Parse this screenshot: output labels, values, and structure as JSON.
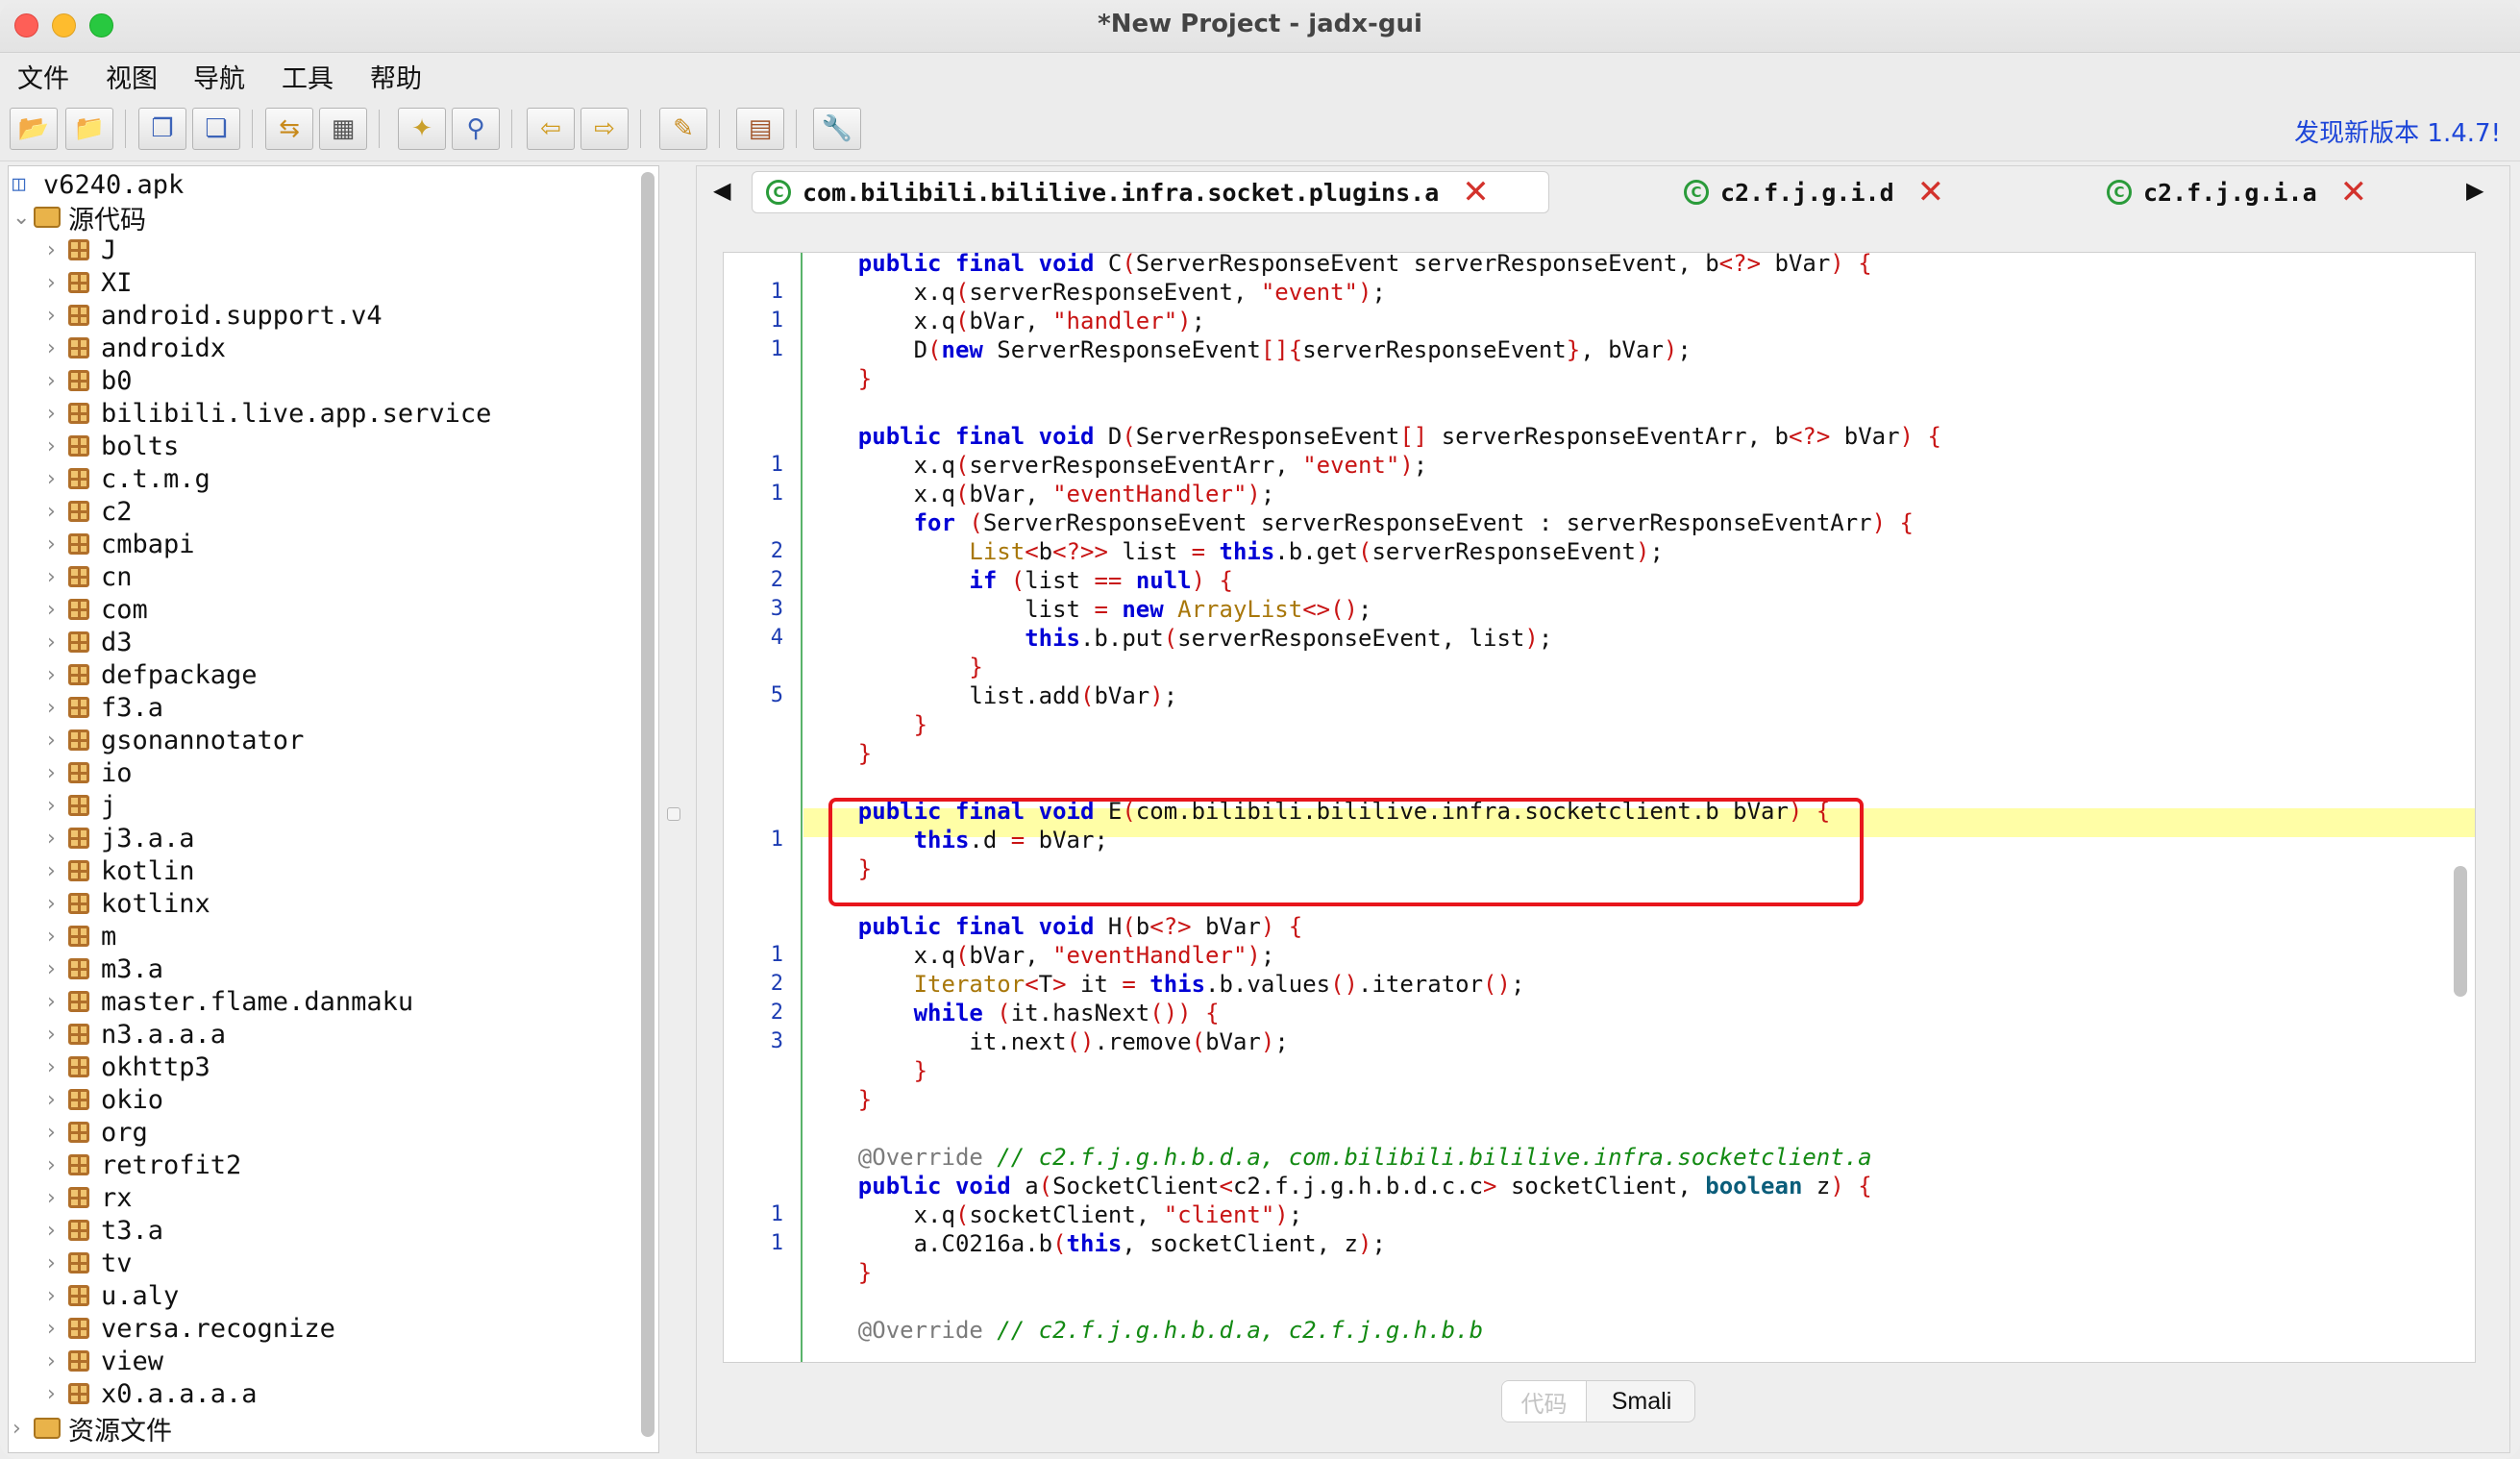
{
  "window": {
    "title": "*New Project - jadx-gui"
  },
  "menu": [
    "文件",
    "视图",
    "导航",
    "工具",
    "帮助"
  ],
  "toolbar": {
    "update_text": "发现新版本 1.4.7!",
    "buttons": [
      "open-file",
      "add-file",
      "save-all",
      "export",
      "sync",
      "decompile",
      "wand",
      "search",
      "back",
      "forward",
      "log",
      "deobf",
      "preferences"
    ]
  },
  "tree": {
    "root": "v6240.apk",
    "source_label": "源代码",
    "packages": [
      "J",
      "XI",
      "android.support.v4",
      "androidx",
      "b0",
      "bilibili.live.app.service",
      "bolts",
      "c.t.m.g",
      "c2",
      "cmbapi",
      "cn",
      "com",
      "d3",
      "defpackage",
      "f3.a",
      "gsonannotator",
      "io",
      "j",
      "j3.a.a",
      "kotlin",
      "kotlinx",
      "m",
      "m3.a",
      "master.flame.danmaku",
      "n3.a.a.a",
      "okhttp3",
      "okio",
      "org",
      "retrofit2",
      "rx",
      "t3.a",
      "tv",
      "u.aly",
      "versa.recognize",
      "view",
      "x0.a.a.a.a"
    ],
    "resources_label": "资源文件"
  },
  "tabs": [
    {
      "label": "com.bilibili.bililive.infra.socket.plugins.a",
      "active": true
    },
    {
      "label": "c2.f.j.g.i.d",
      "active": false
    },
    {
      "label": "c2.f.j.g.i.a",
      "active": false
    }
  ],
  "bottom_tabs": {
    "code": "代码",
    "smali": "Smali"
  },
  "code_lines": [
    {
      "n": "",
      "html": "    <span class='k'>public final void</span> C<span class='o'>(</span>ServerResponseEvent serverResponseEvent, b<span class='o'>&lt;?&gt;</span> bVar<span class='o'>)</span> <span class='o'>{</span>"
    },
    {
      "n": "1",
      "html": "        x.q<span class='o'>(</span>serverResponseEvent, <span class='o'>\"event\"</span><span class='o'>)</span>;"
    },
    {
      "n": "1",
      "html": "        x.q<span class='o'>(</span>bVar, <span class='o'>\"handler\"</span><span class='o'>)</span>;"
    },
    {
      "n": "1",
      "html": "        D<span class='o'>(</span><span class='k'>new</span> ServerResponseEvent<span class='o'>[]{</span>serverResponseEvent<span class='o'>}</span>, bVar<span class='o'>)</span>;"
    },
    {
      "n": "",
      "html": "    <span class='o'>}</span>"
    },
    {
      "n": "",
      "html": ""
    },
    {
      "n": "",
      "html": "    <span class='k'>public final void</span> D<span class='o'>(</span>ServerResponseEvent<span class='o'>[]</span> serverResponseEventArr, b<span class='o'>&lt;?&gt;</span> bVar<span class='o'>)</span> <span class='o'>{</span>"
    },
    {
      "n": "1",
      "html": "        x.q<span class='o'>(</span>serverResponseEventArr, <span class='o'>\"event\"</span><span class='o'>)</span>;"
    },
    {
      "n": "1",
      "html": "        x.q<span class='o'>(</span>bVar, <span class='o'>\"eventHandler\"</span><span class='o'>)</span>;"
    },
    {
      "n": "",
      "html": "        <span class='k'>for</span> <span class='o'>(</span>ServerResponseEvent serverResponseEvent : serverResponseEventArr<span class='o'>)</span> <span class='o'>{</span>"
    },
    {
      "n": "2",
      "html": "            <span class='ty'>List</span><span class='o'>&lt;</span>b<span class='o'>&lt;?&gt;&gt;</span> list <span class='o'>=</span> <span class='k'>this</span>.b.get<span class='o'>(</span>serverResponseEvent<span class='o'>)</span>;"
    },
    {
      "n": "2",
      "html": "            <span class='k'>if</span> <span class='o'>(</span>list <span class='o'>==</span> <span class='k'>null</span><span class='o'>)</span> <span class='o'>{</span>"
    },
    {
      "n": "3",
      "html": "                list <span class='o'>=</span> <span class='k'>new</span> <span class='ty'>ArrayList</span><span class='o'>&lt;&gt;()</span>;"
    },
    {
      "n": "4",
      "html": "                <span class='k'>this</span>.b.put<span class='o'>(</span>serverResponseEvent, list<span class='o'>)</span>;"
    },
    {
      "n": "",
      "html": "            <span class='o'>}</span>"
    },
    {
      "n": "5",
      "html": "            list.add<span class='o'>(</span>bVar<span class='o'>)</span>;"
    },
    {
      "n": "",
      "html": "        <span class='o'>}</span>"
    },
    {
      "n": "",
      "html": "    <span class='o'>}</span>"
    },
    {
      "n": "",
      "html": ""
    },
    {
      "n": "",
      "html": "    <span class='k'>public final void</span> E<span class='o'>(</span>com.bilibili.bililive.infra.socketclient.b bVar<span class='o'>)</span> <span class='o'>{</span>"
    },
    {
      "n": "1",
      "html": "        <span class='k'>this</span>.d <span class='o'>=</span> bVar;"
    },
    {
      "n": "",
      "html": "    <span class='o'>}</span>"
    },
    {
      "n": "",
      "html": ""
    },
    {
      "n": "",
      "html": "    <span class='k'>public final void</span> H<span class='o'>(</span>b<span class='o'>&lt;?&gt;</span> bVar<span class='o'>)</span> <span class='o'>{</span>"
    },
    {
      "n": "1",
      "html": "        x.q<span class='o'>(</span>bVar, <span class='o'>\"eventHandler\"</span><span class='o'>)</span>;"
    },
    {
      "n": "2",
      "html": "        <span class='ty'>Iterator</span><span class='o'>&lt;</span>T<span class='o'>&gt;</span> it <span class='o'>=</span> <span class='k'>this</span>.b.values<span class='o'>()</span>.iterator<span class='o'>()</span>;"
    },
    {
      "n": "2",
      "html": "        <span class='k'>while</span> <span class='o'>(</span>it.hasNext<span class='o'>())</span> <span class='o'>{</span>"
    },
    {
      "n": "3",
      "html": "            it.next<span class='o'>()</span>.remove<span class='o'>(</span>bVar<span class='o'>)</span>;"
    },
    {
      "n": "",
      "html": "        <span class='o'>}</span>"
    },
    {
      "n": "",
      "html": "    <span class='o'>}</span>"
    },
    {
      "n": "",
      "html": ""
    },
    {
      "n": "",
      "html": "    <span class='an'>@Override</span> <span class='cm'>// c2.f.j.g.h.b.d.a, com.bilibili.bililive.infra.socketclient.a</span>"
    },
    {
      "n": "",
      "html": "    <span class='k'>public void</span> a<span class='o'>(</span>SocketClient<span class='o'>&lt;</span>c2.f.j.g.h.b.d.c.c<span class='o'>&gt;</span> socketClient, <span class='k' style='color:#0b5d7a'>boolean</span> z<span class='o'>)</span> <span class='o'>{</span>"
    },
    {
      "n": "1",
      "html": "        x.q<span class='o'>(</span>socketClient, <span class='o'>\"client\"</span><span class='o'>)</span>;"
    },
    {
      "n": "1",
      "html": "        a.C0216a.b<span class='o'>(</span><span class='k'>this</span>, socketClient, z<span class='o'>)</span>;"
    },
    {
      "n": "",
      "html": "    <span class='o'>}</span>"
    },
    {
      "n": "",
      "html": ""
    },
    {
      "n": "",
      "html": "    <span class='an'>@Override</span> <span class='cm'>// c2.f.j.g.h.b.d.a, c2.f.j.g.h.b.b</span>"
    }
  ],
  "highlight_line_index": 19,
  "colors": {
    "keyword": "#0000d6",
    "string": "#c81414",
    "comment": "#138a13",
    "line_number": "#1d3db3",
    "highlight": "#fffea6",
    "annotation_box": "#e8151c",
    "update_link": "#1c45d8"
  }
}
